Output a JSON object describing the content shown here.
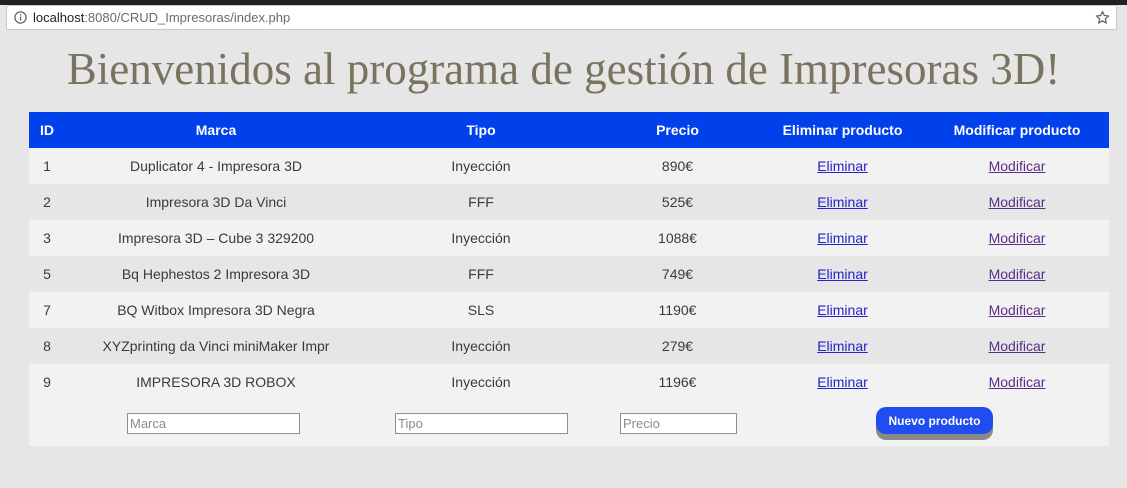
{
  "browser": {
    "url_host": "localhost",
    "url_rest": ":8080/CRUD_Impresoras/index.php"
  },
  "page": {
    "title": "Bienvenidos al programa de gestión de Impresoras 3D!"
  },
  "table": {
    "headers": {
      "id": "ID",
      "marca": "Marca",
      "tipo": "Tipo",
      "precio": "Precio",
      "eliminar": "Eliminar producto",
      "modificar": "Modificar producto"
    },
    "rows": [
      {
        "id": "1",
        "marca": "Duplicator 4 - Impresora 3D",
        "tipo": "Inyección",
        "precio": "890€",
        "eliminar": "Eliminar",
        "modificar": "Modificar"
      },
      {
        "id": "2",
        "marca": "Impresora 3D Da Vinci",
        "tipo": "FFF",
        "precio": "525€",
        "eliminar": "Eliminar",
        "modificar": "Modificar"
      },
      {
        "id": "3",
        "marca": "Impresora 3D – Cube 3 329200",
        "tipo": "Inyección",
        "precio": "1088€",
        "eliminar": "Eliminar",
        "modificar": "Modificar"
      },
      {
        "id": "5",
        "marca": "Bq Hephestos 2 Impresora 3D",
        "tipo": "FFF",
        "precio": "749€",
        "eliminar": "Eliminar",
        "modificar": "Modificar"
      },
      {
        "id": "7",
        "marca": "BQ Witbox Impresora 3D Negra",
        "tipo": "SLS",
        "precio": "1190€",
        "eliminar": "Eliminar",
        "modificar": "Modificar"
      },
      {
        "id": "8",
        "marca": "XYZprinting da Vinci miniMaker Impr",
        "tipo": "Inyección",
        "precio": "279€",
        "eliminar": "Eliminar",
        "modificar": "Modificar"
      },
      {
        "id": "9",
        "marca": "IMPRESORA 3D ROBOX",
        "tipo": "Inyección",
        "precio": "1196€",
        "eliminar": "Eliminar",
        "modificar": "Modificar"
      }
    ]
  },
  "new_product": {
    "marca_placeholder": "Marca",
    "tipo_placeholder": "Tipo",
    "precio_placeholder": "Precio",
    "button_label": "Nuevo producto"
  },
  "colors": {
    "header_bg": "#0041ec",
    "title_color": "#7a735f",
    "button_bg": "#1f4df0"
  }
}
